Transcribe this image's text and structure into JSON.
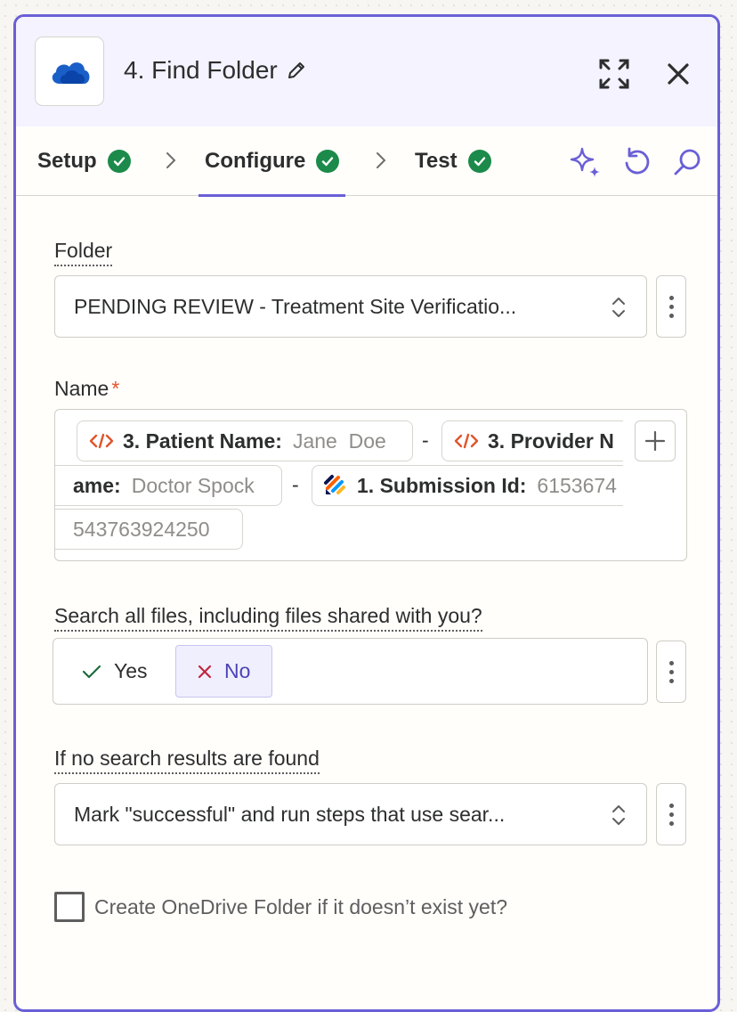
{
  "header": {
    "app_icon": "onedrive-cloud-icon",
    "title": "4. Find Folder"
  },
  "tabs": [
    {
      "label": "Setup",
      "status": "complete"
    },
    {
      "label": "Configure",
      "status": "complete"
    },
    {
      "label": "Test",
      "status": "complete"
    }
  ],
  "fields": {
    "folder": {
      "label": "Folder",
      "value": "PENDING REVIEW - Treatment Site Verificatio..."
    },
    "name": {
      "label": "Name",
      "required_mark": "*",
      "separator": "-",
      "tokens": [
        {
          "icon": "code-icon",
          "label": "3. Patient Name:",
          "value": "Jane  Doe"
        },
        {
          "icon": "code-icon",
          "label_line1": "3. Provider N",
          "label_line2": "ame:",
          "value": "Doctor Spock"
        },
        {
          "icon": "jotform-icon",
          "label": "1. Submission Id:",
          "value_line1": "6153674",
          "value_line2": "543763924250"
        }
      ]
    },
    "search_all": {
      "label": "Search all files, including files shared with you?",
      "yes_label": "Yes",
      "no_label": "No",
      "selected": "No"
    },
    "no_results": {
      "label": "If no search results are found",
      "value": "Mark \"successful\" and run steps that use sear..."
    },
    "create_folder": {
      "label": "Create OneDrive Folder if it doesn’t exist yet?",
      "checked": false
    }
  },
  "colors": {
    "accent": "#6a5fd6",
    "success": "#1c8a4a",
    "token_orange": "#e0552b",
    "header_bg": "#f4f3ff",
    "required": "#e0552b"
  }
}
